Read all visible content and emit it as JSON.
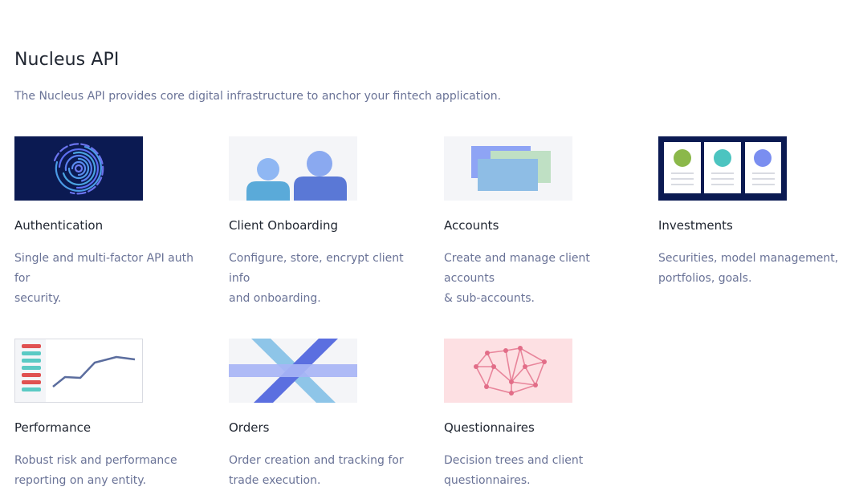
{
  "page": {
    "title": "Nucleus API",
    "subtitle": "The Nucleus API provides core digital infrastructure to anchor your fintech application."
  },
  "cards": [
    {
      "title": "Authentication",
      "desc_line1": "Single and multi-factor API auth for",
      "desc_line2": "security.",
      "icon": "fingerprint-icon"
    },
    {
      "title": "Client Onboarding",
      "desc_line1": "Configure, store, encrypt client info",
      "desc_line2": "and onboarding.",
      "icon": "people-icon"
    },
    {
      "title": "Accounts",
      "desc_line1": "Create and manage client accounts",
      "desc_line2": "& sub-accounts.",
      "icon": "stacked-cards-icon"
    },
    {
      "title": "Investments",
      "desc_line1": "Securities, model management,",
      "desc_line2": "portfolios, goals.",
      "icon": "portfolio-cards-icon"
    },
    {
      "title": "Performance",
      "desc_line1": "Robust risk and performance",
      "desc_line2": "reporting on any entity.",
      "icon": "line-chart-icon"
    },
    {
      "title": "Orders",
      "desc_line1": "Order creation and tracking for",
      "desc_line2": "trade execution.",
      "icon": "crossing-arrows-icon"
    },
    {
      "title": "Questionnaires",
      "desc_line1": "Decision trees and client",
      "desc_line2": "questionnaires.",
      "icon": "network-nodes-icon"
    }
  ]
}
